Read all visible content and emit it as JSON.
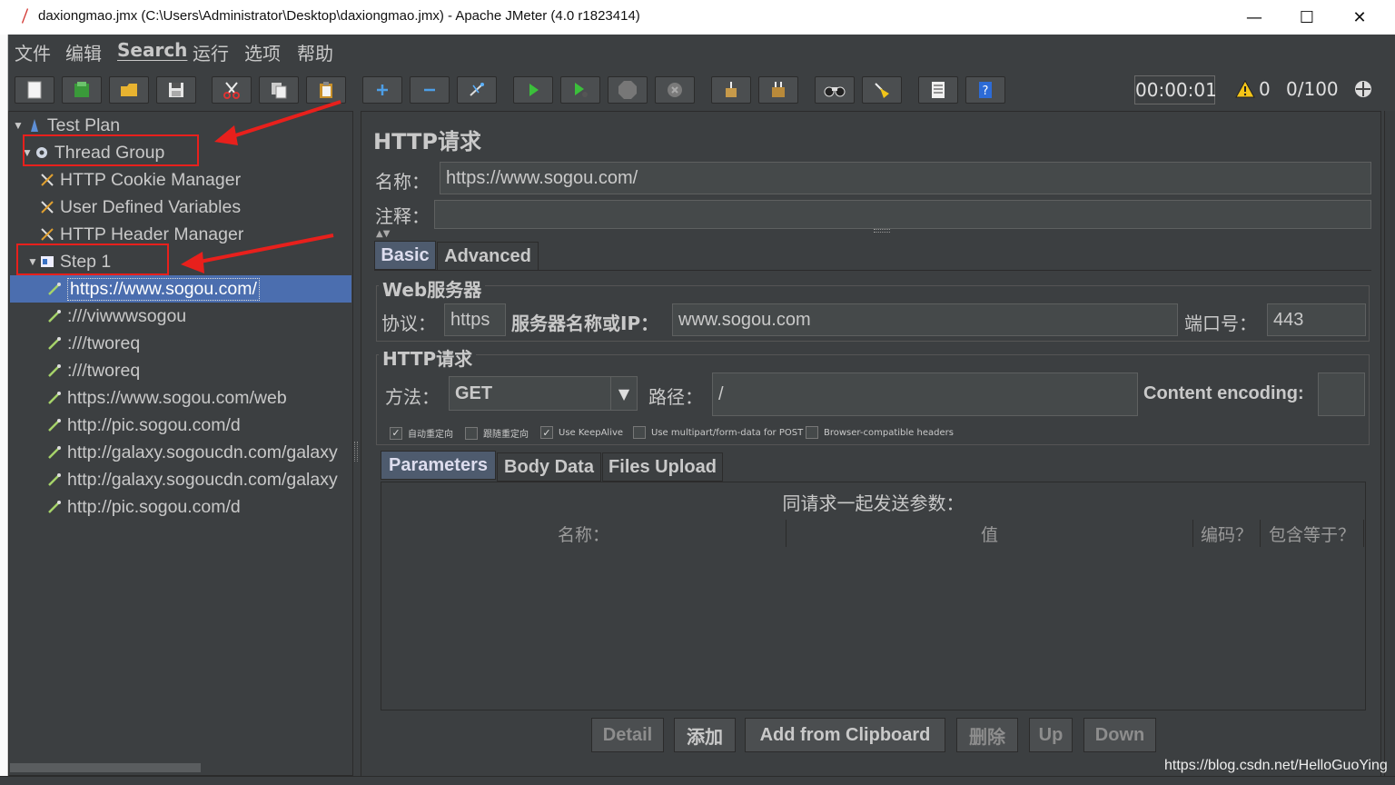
{
  "window": {
    "title": "daxiongmao.jmx (C:\\Users\\Administrator\\Desktop\\daxiongmao.jmx) - Apache JMeter (4.0 r1823414)",
    "minimize": "—",
    "maximize": "☐",
    "close": "✕"
  },
  "menu": [
    "文件",
    "编辑",
    "Search",
    "运行",
    "选项",
    "帮助"
  ],
  "status": {
    "elapsed": "00:00:01",
    "warnings": "0",
    "threads": "0/100"
  },
  "tree": {
    "items": [
      "Test Plan",
      "Thread Group",
      "HTTP Cookie Manager",
      "User Defined Variables",
      "HTTP Header Manager",
      "Step 1",
      "https://www.sogou.com/",
      ":///viwwwsogou",
      ":///tworeq",
      ":///tworeq",
      "https://www.sogou.com/web",
      "http://pic.sogou.com/d",
      "http://galaxy.sogoucdn.com/galaxy",
      "http://galaxy.sogoucdn.com/galaxy",
      "http://pic.sogou.com/d"
    ]
  },
  "panel": {
    "title": "HTTP请求",
    "name_label": "名称：",
    "name_value": "https://www.sogou.com/",
    "comment_label": "注释：",
    "comment_value": "",
    "tabs": [
      "Basic",
      "Advanced"
    ],
    "web_server": {
      "title": "Web服务器",
      "protocol_label": "协议：",
      "protocol_value": "https",
      "server_label": "服务器名称或IP：",
      "server_value": "www.sogou.com",
      "port_label": "端口号：",
      "port_value": "443"
    },
    "http_request": {
      "title": "HTTP请求",
      "method_label": "方法：",
      "method_value": "GET",
      "path_label": "路径：",
      "path_value": "/",
      "encoding_label": "Content encoding:",
      "encoding_value": ""
    },
    "checkboxes": [
      {
        "label": "自动重定向",
        "checked": true
      },
      {
        "label": "跟随重定向",
        "checked": false
      },
      {
        "label": "Use KeepAlive",
        "checked": true
      },
      {
        "label": "Use multipart/form-data for POST",
        "checked": false
      },
      {
        "label": "Browser-compatible headers",
        "checked": false
      }
    ],
    "param_tabs": [
      "Parameters",
      "Body Data",
      "Files Upload"
    ],
    "params_caption": "同请求一起发送参数：",
    "columns": [
      "名称：",
      "值",
      "编码？",
      "包含等于？"
    ],
    "buttons": [
      "Detail",
      "添加",
      "Add from Clipboard",
      "删除",
      "Up",
      "Down"
    ]
  },
  "watermark": "https://blog.csdn.net/HelloGuoYing"
}
